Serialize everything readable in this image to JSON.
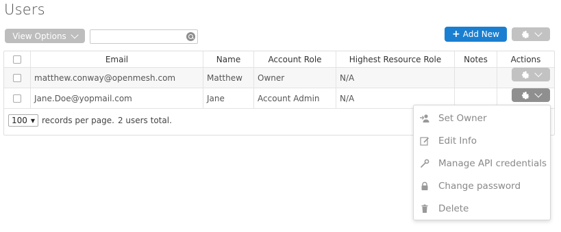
{
  "page": {
    "title": "Users"
  },
  "toolbar": {
    "view_options_label": "View Options",
    "search_value": "",
    "add_new_label": "Add New"
  },
  "table": {
    "columns": [
      "",
      "Email",
      "Name",
      "Account Role",
      "Highest Resource Role",
      "Notes",
      "Actions"
    ],
    "rows": [
      {
        "email": "matthew.conway@openmesh.com",
        "name": "Matthew",
        "account_role": "Owner",
        "highest_resource_role": "N/A",
        "notes": ""
      },
      {
        "email": "Jane.Doe@yopmail.com",
        "name": "Jane",
        "account_role": "Account Admin",
        "highest_resource_role": "N/A",
        "notes": ""
      }
    ],
    "footer": {
      "per_page_value": "100",
      "per_page_label": "records per page.",
      "total_text": "2 users total."
    }
  },
  "actions_menu": {
    "items": [
      {
        "label": "Set Owner",
        "icon": "person-add-icon"
      },
      {
        "label": "Edit Info",
        "icon": "edit-icon"
      },
      {
        "label": "Manage API credentials",
        "icon": "wrench-icon"
      },
      {
        "label": "Change password",
        "icon": "lock-icon"
      },
      {
        "label": "Delete",
        "icon": "trash-icon"
      }
    ]
  },
  "colors": {
    "primary": "#1a7fd1",
    "muted_button": "#c2c2c2",
    "active_button": "#8f8f8f",
    "menu_text": "#888888"
  }
}
